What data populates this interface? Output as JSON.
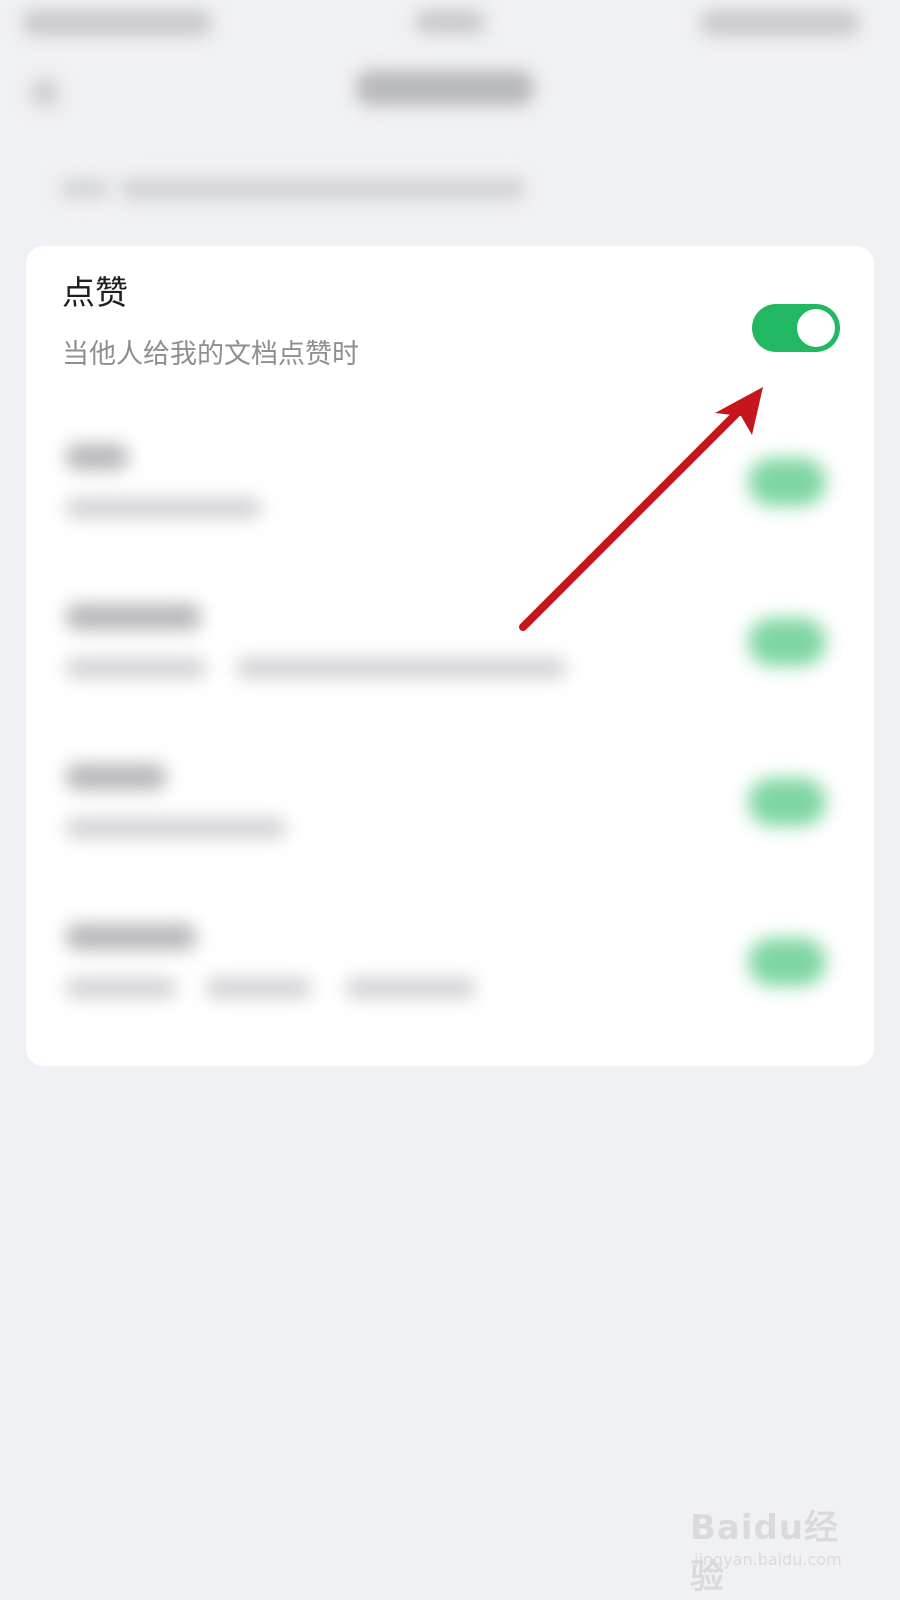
{
  "setting": {
    "title": "点赞",
    "subtitle": "当他人给我的文档点赞时",
    "enabled": true
  },
  "colors": {
    "background": "#f0f1f4",
    "card": "#ffffff",
    "toggle_on": "#22b862",
    "annotation_arrow": "#c4161c"
  },
  "watermark": {
    "logo": "Baidu经验",
    "url": "jingyan.baidu.com"
  }
}
